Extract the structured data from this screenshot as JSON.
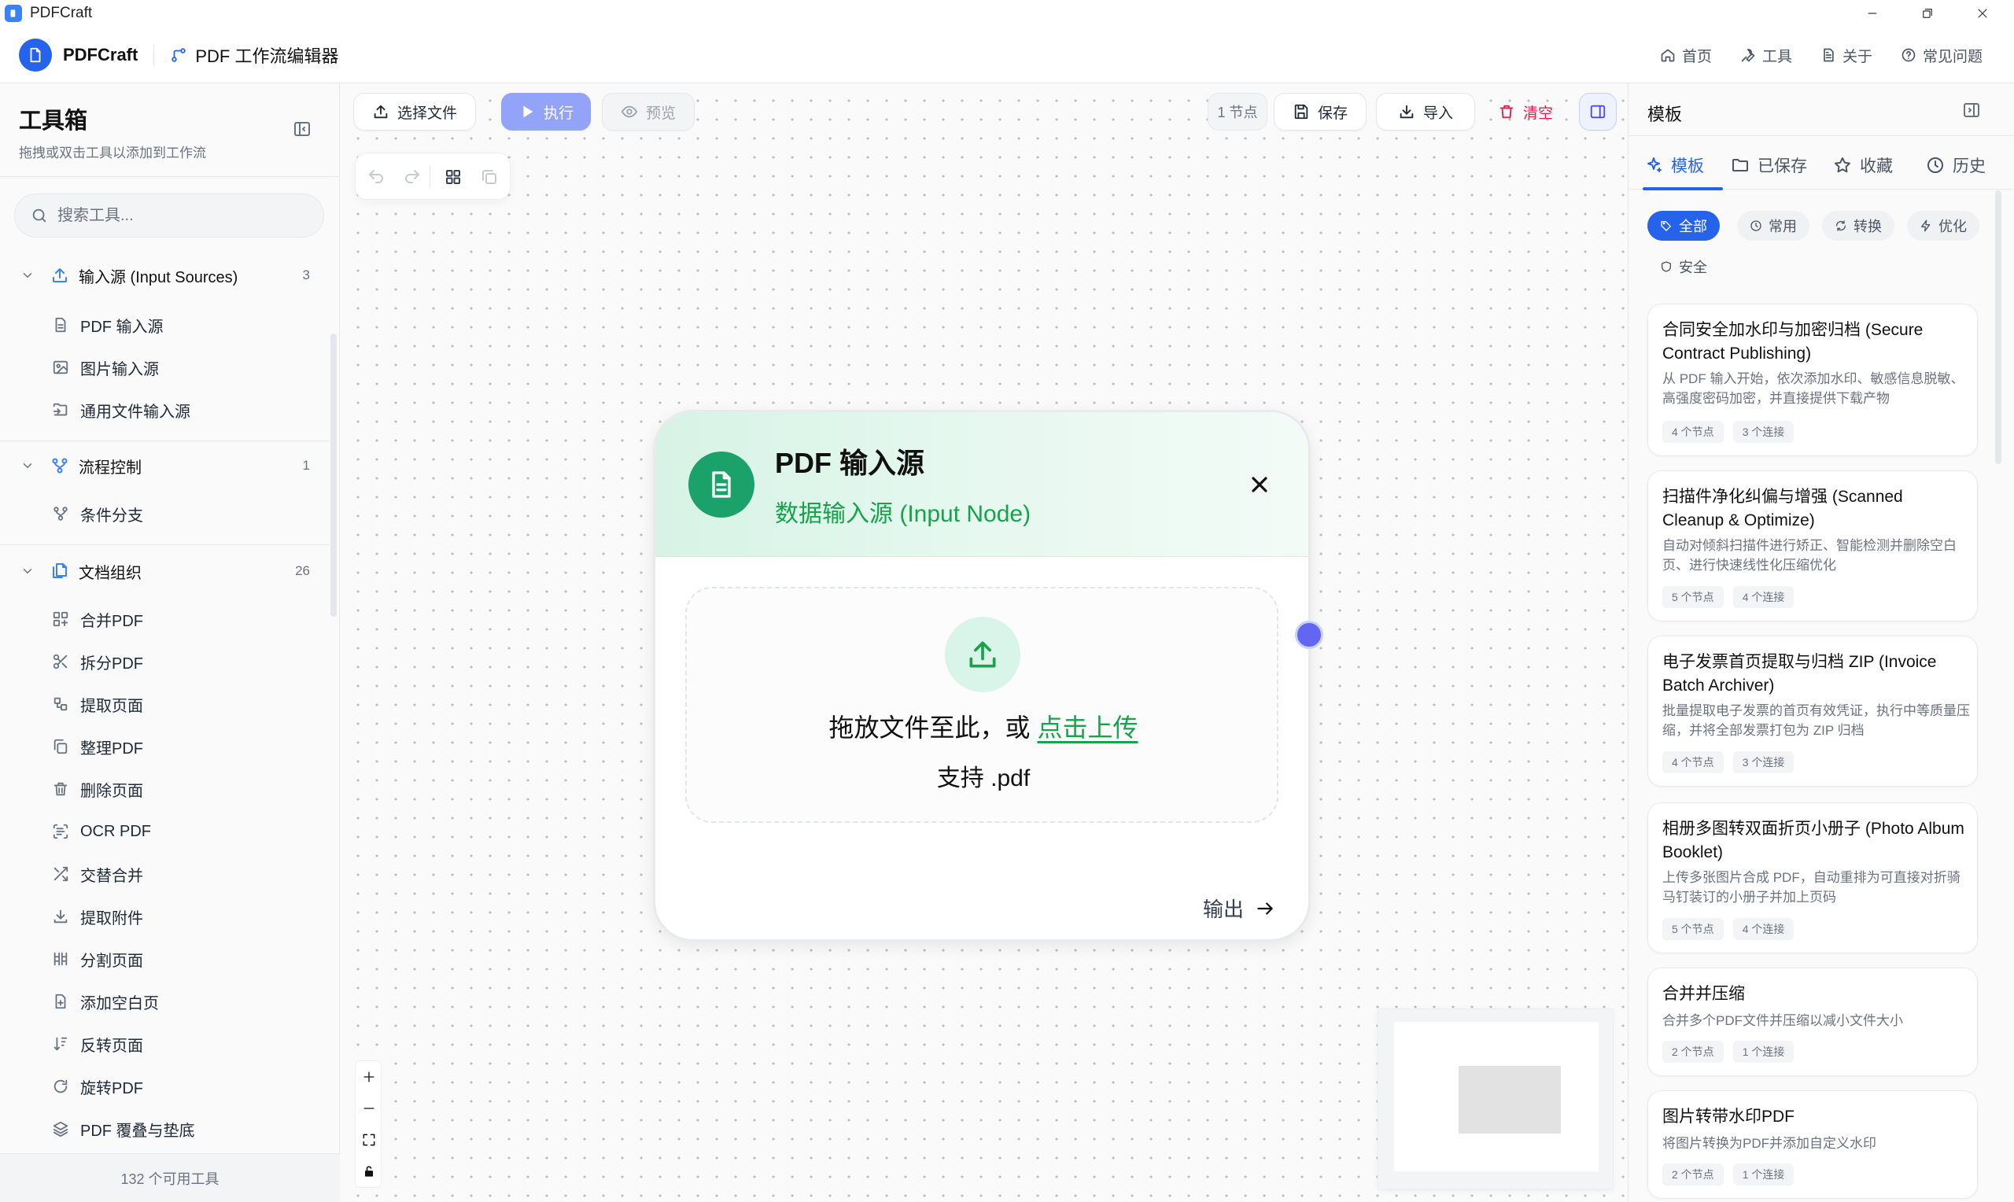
{
  "window": {
    "title": "PDFCraft"
  },
  "header": {
    "brand": "PDFCraft",
    "editor_title": "PDF 工作流编辑器",
    "nav": [
      {
        "label": "首页",
        "icon": "home-icon"
      },
      {
        "label": "工具",
        "icon": "wrench-icon"
      },
      {
        "label": "关于",
        "icon": "document-icon"
      },
      {
        "label": "常见问题",
        "icon": "help-circle-icon"
      }
    ]
  },
  "sidebar": {
    "title": "工具箱",
    "subtitle": "拖拽或双击工具以添加到工作流",
    "search_placeholder": "搜索工具...",
    "groups": [
      {
        "label": "输入源 (Input Sources)",
        "count": "3",
        "items": [
          "PDF 输入源",
          "图片输入源",
          "通用文件输入源"
        ]
      },
      {
        "label": "流程控制",
        "count": "1",
        "items": [
          "条件分支"
        ]
      },
      {
        "label": "文档组织",
        "count": "26",
        "items": [
          "合并PDF",
          "拆分PDF",
          "提取页面",
          "整理PDF",
          "删除页面",
          "OCR PDF",
          "交替合并",
          "提取附件",
          "分割页面",
          "添加空白页",
          "反转页面",
          "旋转PDF",
          "PDF 覆叠与垫底"
        ]
      }
    ],
    "footer": "132 个可用工具"
  },
  "toolbar": {
    "select_file": "选择文件",
    "execute": "执行",
    "preview": "预览",
    "node_count": "1 节点",
    "save": "保存",
    "import": "导入",
    "clear": "清空"
  },
  "node": {
    "title": "PDF 输入源",
    "subtitle": "数据输入源 (Input Node)",
    "drop_text": "拖放文件至此，或 ",
    "drop_link": "点击上传",
    "support": "支持 .pdf",
    "output_label": "输出"
  },
  "right_panel": {
    "title": "模板",
    "tabs": [
      {
        "label": "模板",
        "icon": "sparkles-icon",
        "active": true
      },
      {
        "label": "已保存",
        "icon": "folder-icon",
        "active": false
      },
      {
        "label": "收藏",
        "icon": "star-icon",
        "active": false
      },
      {
        "label": "历史",
        "icon": "clock-icon",
        "active": false
      }
    ],
    "chips": [
      {
        "label": "全部",
        "active": true
      },
      {
        "label": "常用",
        "active": false
      },
      {
        "label": "转换",
        "active": false
      },
      {
        "label": "优化",
        "active": false
      },
      {
        "label": "安全",
        "active": false
      }
    ],
    "templates": [
      {
        "title": "合同安全加水印与加密归档 (Secure Contract Publishing)",
        "desc": "从 PDF 输入开始，依次添加水印、敏感信息脱敏、高强度密码加密，并直接提供下载产物",
        "nodes": "4 个节点",
        "links": "3 个连接"
      },
      {
        "title": "扫描件净化纠偏与增强 (Scanned Cleanup & Optimize)",
        "desc": "自动对倾斜扫描件进行矫正、智能检测并删除空白页、进行快速线性化压缩优化",
        "nodes": "5 个节点",
        "links": "4 个连接"
      },
      {
        "title": "电子发票首页提取与归档 ZIP (Invoice Batch Archiver)",
        "desc": "批量提取电子发票的首页有效凭证，执行中等质量压缩，并将全部发票打包为 ZIP 归档",
        "nodes": "4 个节点",
        "links": "3 个连接"
      },
      {
        "title": "相册多图转双面折页小册子 (Photo Album Booklet)",
        "desc": "上传多张图片合成 PDF，自动重排为可直接对折骑马钉装订的小册子并加上页码",
        "nodes": "5 个节点",
        "links": "4 个连接"
      },
      {
        "title": "合并并压缩",
        "desc": "合并多个PDF文件并压缩以减小文件大小",
        "nodes": "2 个节点",
        "links": "1 个连接"
      },
      {
        "title": "图片转带水印PDF",
        "desc": "将图片转换为PDF并添加自定义水印",
        "nodes": "2 个节点",
        "links": "1 个连接"
      }
    ]
  },
  "colors": {
    "accent": "#2563eb",
    "node_green": "#1aa26a",
    "handle": "#6366f1",
    "danger": "#e11d48"
  }
}
